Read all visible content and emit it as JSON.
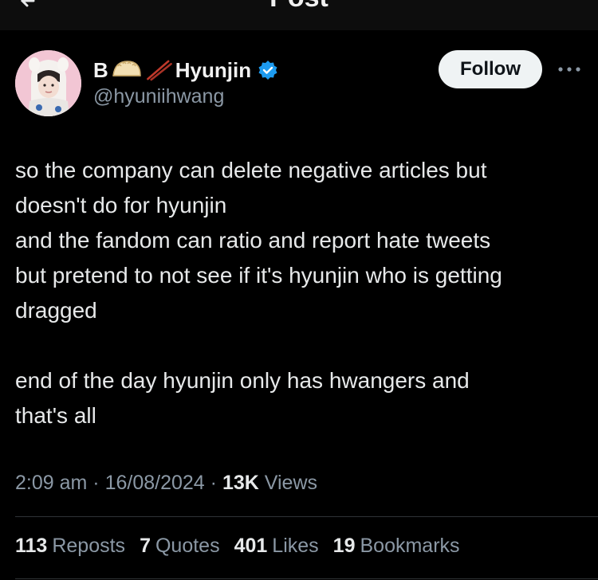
{
  "header": {
    "title": "Post"
  },
  "author": {
    "name_prefix": "B",
    "name": "Hyunjin",
    "handle": "@hyuniihwang",
    "verified": true,
    "verified_color": "#1d9bf0"
  },
  "follow_button": {
    "label": "Follow"
  },
  "tweet": {
    "lines": [
      "so the company can delete negative articles but",
      "doesn't do for hyunjin",
      "and the fandom can ratio and report hate tweets",
      "but pretend to not see if it's hyunjin who is getting",
      "dragged",
      "end of the day hyunjin only has hwangers and",
      "that's all"
    ]
  },
  "meta": {
    "time": "2:09 am",
    "date": "16/08/2024",
    "views_count": "13K",
    "views_label": "Views",
    "separator": "·"
  },
  "stats": {
    "reposts": {
      "count": "113",
      "label": "Reposts"
    },
    "quotes": {
      "count": "7",
      "label": "Quotes"
    },
    "likes": {
      "count": "401",
      "label": "Likes"
    },
    "bookmarks": {
      "count": "19",
      "label": "Bookmarks"
    }
  },
  "colors": {
    "background": "#000000",
    "text": "#e7e9ea",
    "secondary_text": "#8b98a5",
    "follow_bg": "#eff3f4",
    "divider": "#2f3336"
  },
  "icons": [
    "back-arrow-icon",
    "dumpling-emoji-icon",
    "chopsticks-emoji-icon",
    "verified-badge-icon",
    "more-options-icon"
  ]
}
